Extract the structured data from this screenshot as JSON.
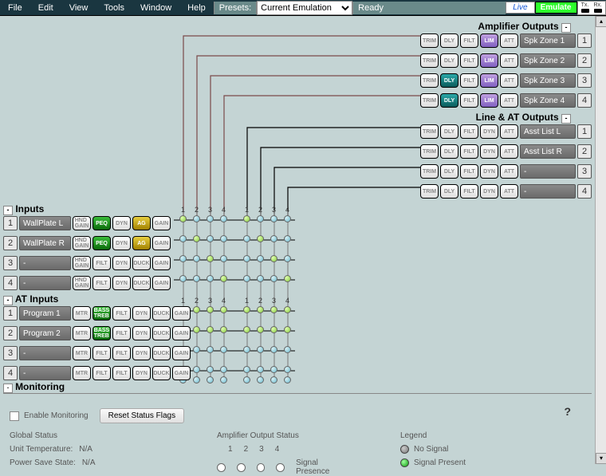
{
  "menu": {
    "file": "File",
    "edit": "Edit",
    "view": "View",
    "tools": "Tools",
    "window": "Window",
    "help": "Help"
  },
  "toolbar": {
    "presets_label": "Presets:",
    "preset_value": "Current Emulation",
    "status": "Ready",
    "live": "Live",
    "emulate": "Emulate",
    "tx": "Tx.",
    "rx": "Rx."
  },
  "amp": {
    "title": "Amplifier Outputs",
    "rows": [
      {
        "name": "Spk Zone 1",
        "num": "1"
      },
      {
        "name": "Spk Zone 2",
        "num": "2"
      },
      {
        "name": "Spk Zone 3",
        "num": "3"
      },
      {
        "name": "Spk Zone 4",
        "num": "4"
      }
    ],
    "chips": [
      "TRIM",
      "DLY",
      "FILT",
      "LIM",
      "ATT"
    ]
  },
  "lineat": {
    "title": "Line & AT Outputs",
    "rows": [
      {
        "name": "Asst List L",
        "num": "1"
      },
      {
        "name": "Asst List R",
        "num": "2"
      },
      {
        "name": "-",
        "num": "3"
      },
      {
        "name": "-",
        "num": "4"
      }
    ],
    "chips": [
      "TRIM",
      "DLY",
      "FILT",
      "DYN",
      "ATT"
    ]
  },
  "inputs": {
    "title": "Inputs",
    "rows": [
      {
        "num": "1",
        "name": "WallPlate L",
        "peq": true,
        "ag": true
      },
      {
        "num": "2",
        "name": "WallPlate R",
        "peq": true,
        "ag": true
      },
      {
        "num": "3",
        "name": "-",
        "peq": false,
        "ag": false
      },
      {
        "num": "4",
        "name": "-",
        "peq": false,
        "ag": false
      }
    ],
    "chips_peq": [
      "HND\nGAIN",
      "PEQ",
      "DYN",
      "AG",
      "GAIN"
    ],
    "chips_plain": [
      "HND\nGAIN",
      "FILT",
      "DYN",
      "DUCK",
      "GAIN"
    ]
  },
  "atinputs": {
    "title": "AT Inputs",
    "rows": [
      {
        "num": "1",
        "name": "Program 1",
        "bt": true
      },
      {
        "num": "2",
        "name": "Program 2",
        "bt": true
      },
      {
        "num": "3",
        "name": "-",
        "bt": false
      },
      {
        "num": "4",
        "name": "-",
        "bt": false
      }
    ],
    "chips_bt": [
      "MTR",
      "BASS\nTREB",
      "FILT",
      "DYN",
      "DUCK",
      "GAIN"
    ],
    "chips_plain": [
      "MTR",
      "FILT",
      "FILT",
      "DYN",
      "DUCK",
      "GAIN"
    ]
  },
  "matrix": {
    "cols_a": [
      "1",
      "2",
      "3",
      "4"
    ],
    "cols_b": [
      "1",
      "2",
      "3",
      "4"
    ]
  },
  "monitoring": {
    "title": "Monitoring",
    "enable": "Enable Monitoring",
    "reset": "Reset Status Flags",
    "global": "Global Status",
    "unit_temp_lbl": "Unit Temperature:",
    "unit_temp_val": "N/A",
    "pss_lbl": "Power Save State:",
    "pss_val": "N/A",
    "amp_status": "Amplifier Output Status",
    "amp_cols": [
      "1",
      "2",
      "3",
      "4"
    ],
    "sig_presence": "Signal Presence",
    "legend": "Legend",
    "no_signal": "No Signal",
    "sig_present": "Signal Present",
    "help": "?"
  }
}
